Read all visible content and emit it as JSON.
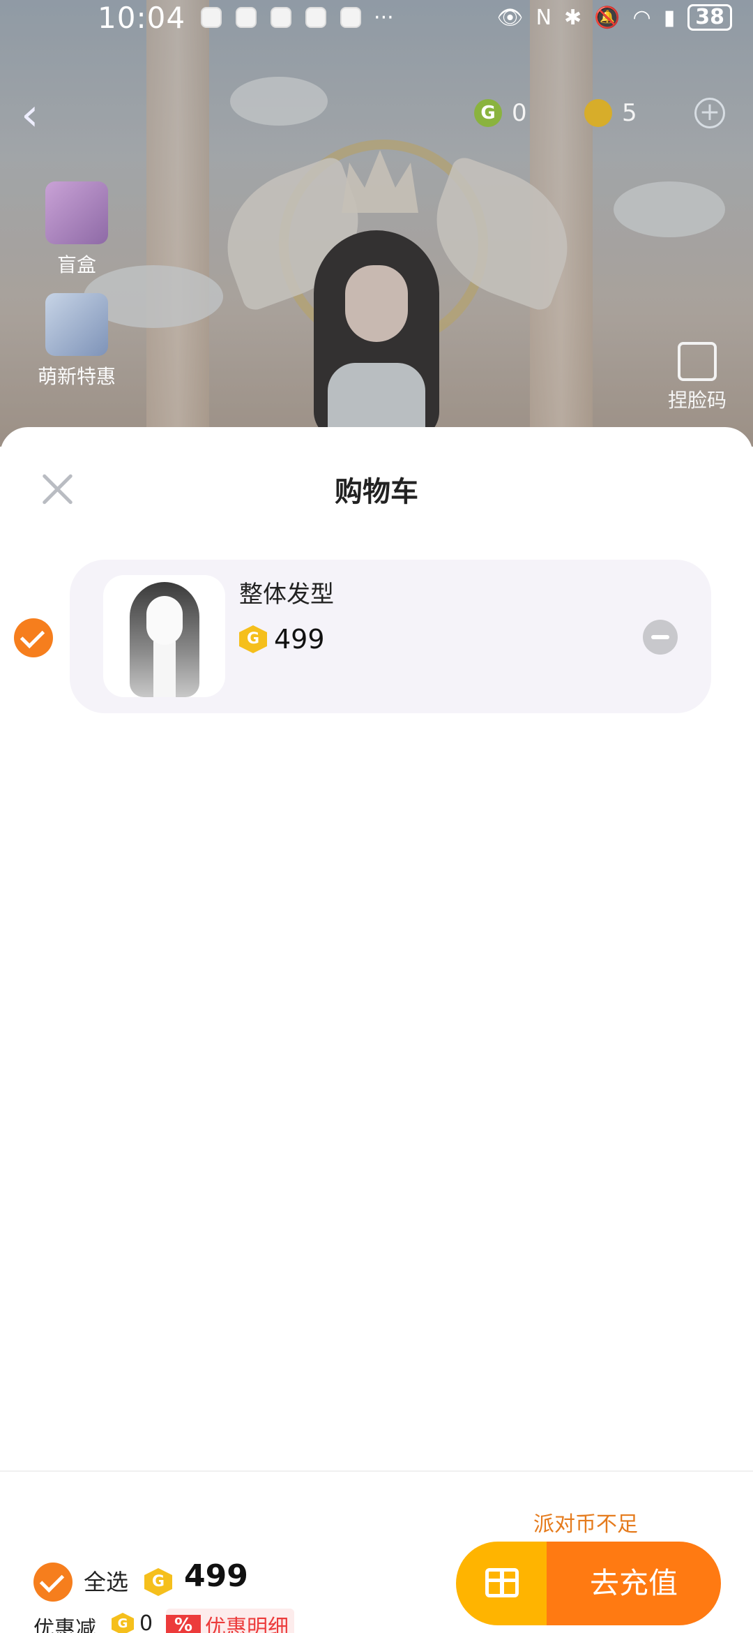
{
  "status_bar": {
    "time": "10:04",
    "more": "···",
    "battery": "38"
  },
  "topbar": {
    "currency_green_value": "0",
    "currency_gold_value": "5"
  },
  "side": {
    "blind_box_label": "盲盒",
    "newbie_label": "萌新特惠",
    "face_code_label": "捏脸码"
  },
  "cart": {
    "title": "购物车",
    "items": [
      {
        "name": "整体发型",
        "price": "499",
        "selected": true
      }
    ]
  },
  "footer": {
    "select_all_label": "全选",
    "total": "499",
    "discount_label": "优惠减",
    "discount_value": "0",
    "discount_badge": "%",
    "discount_detail": "优惠明细",
    "insufficient_notice": "派对币不足",
    "recharge_label": "去充值"
  },
  "colors": {
    "accent_orange": "#f67e1d",
    "button_orange": "#ff7a12",
    "button_yellow": "#ffb400",
    "coin_gold": "#f5bf1c",
    "discount_red": "#ec3b3b"
  }
}
